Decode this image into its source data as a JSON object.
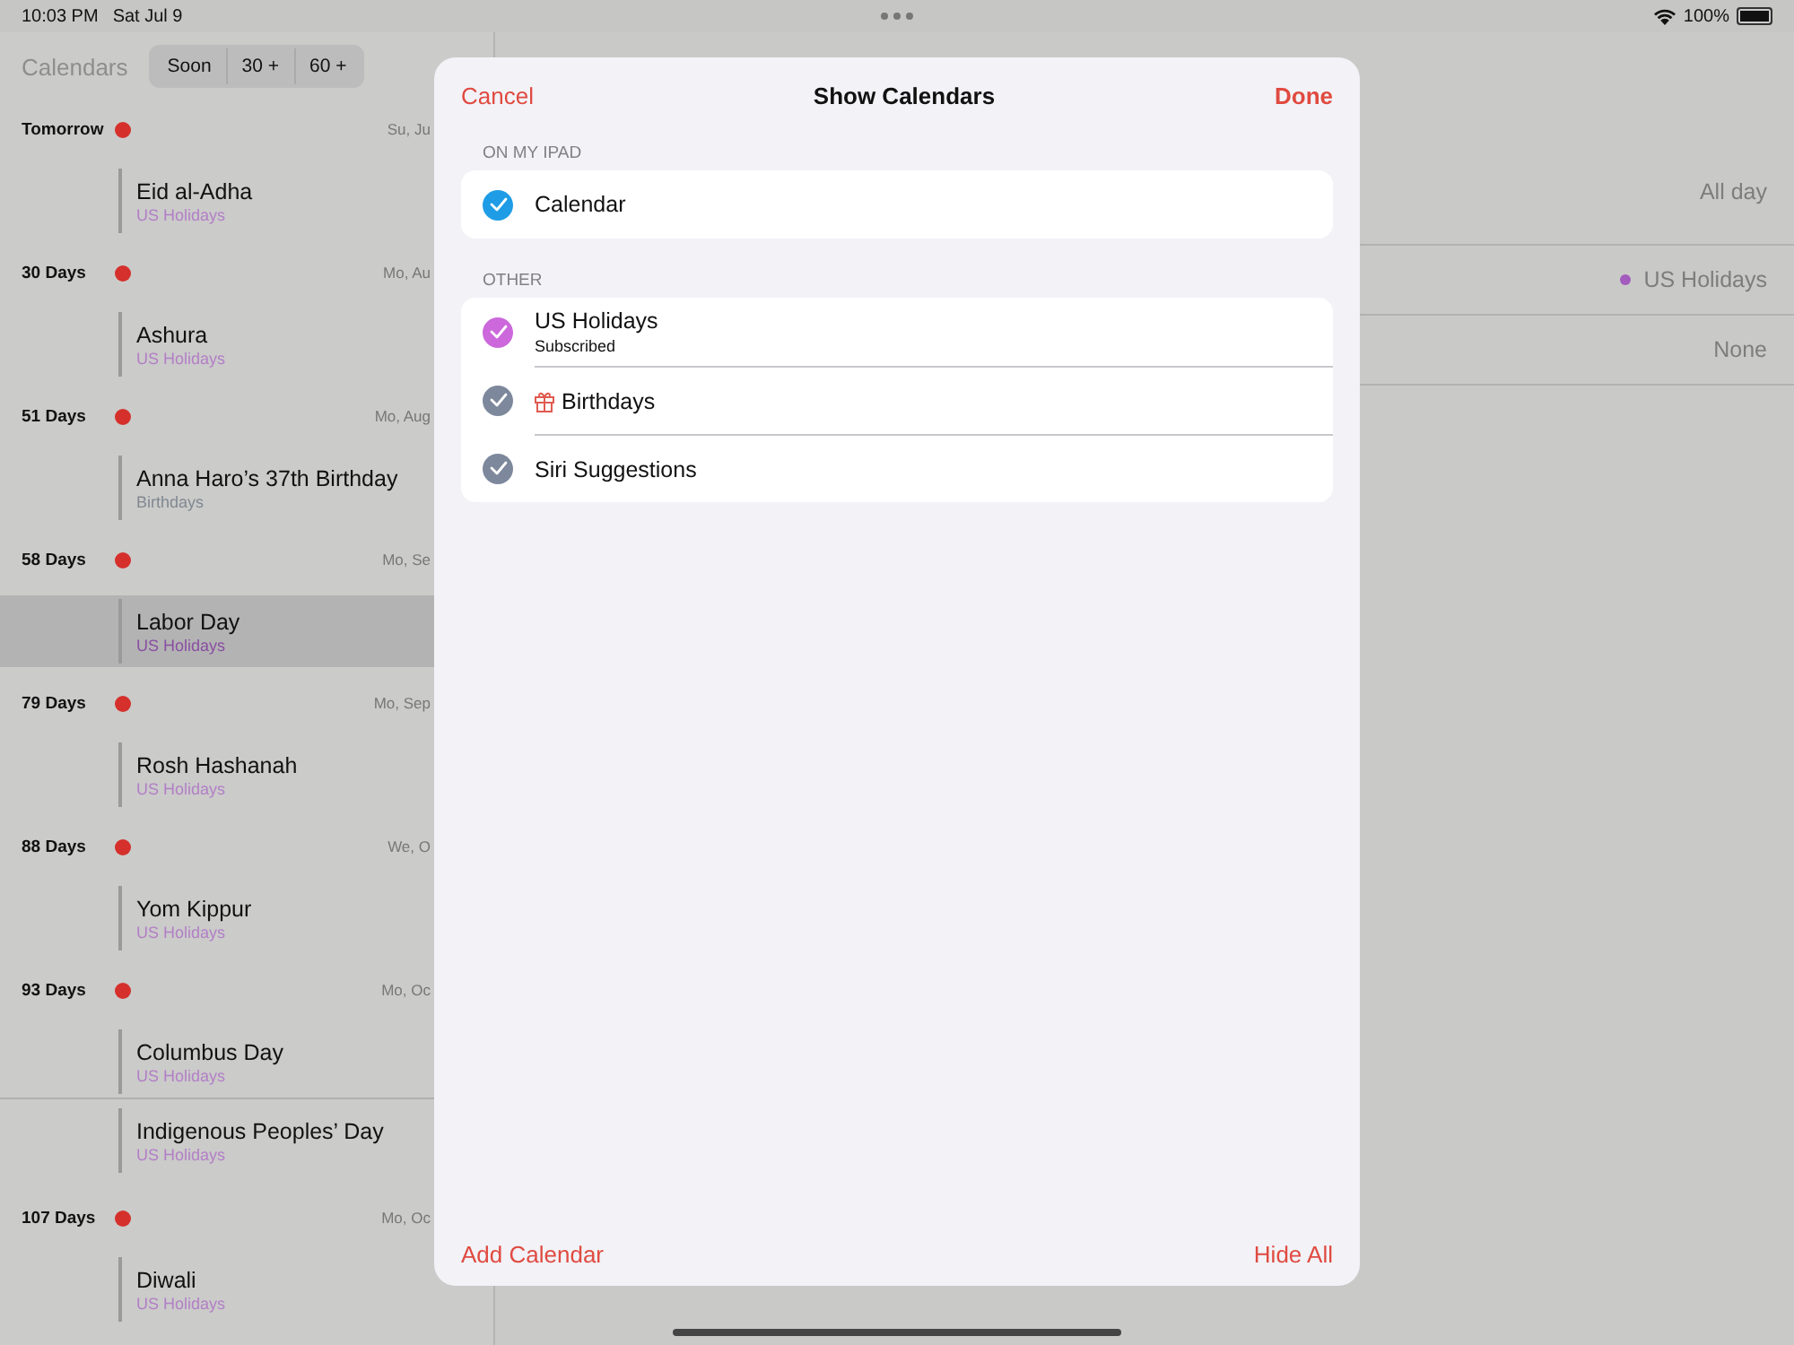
{
  "status_bar": {
    "time": "10:03 PM",
    "date": "Sat Jul 9",
    "battery": "100%"
  },
  "sidebar": {
    "title": "Calendars",
    "segments": [
      "Soon",
      "30 +",
      "60 +"
    ],
    "groups": [
      {
        "label": "Tomorrow",
        "date": "Su, Ju",
        "events": [
          {
            "title": "Eid al-Adha",
            "calendar": "US Holidays",
            "color": "#b27fc6",
            "selected": false
          }
        ]
      },
      {
        "label": "30 Days",
        "date": "Mo, Au",
        "events": [
          {
            "title": "Ashura",
            "calendar": "US Holidays",
            "color": "#b27fc6",
            "selected": false
          }
        ]
      },
      {
        "label": "51 Days",
        "date": "Mo, Aug",
        "events": [
          {
            "title": "Anna Haro’s 37th Birthday",
            "calendar": "Birthdays",
            "color": "#808890",
            "selected": false
          }
        ]
      },
      {
        "label": "58 Days",
        "date": "Mo, Se",
        "events": [
          {
            "title": "Labor Day",
            "calendar": "US Holidays",
            "color": "#8a4fa3",
            "selected": true
          }
        ]
      },
      {
        "label": "79 Days",
        "date": "Mo, Sep",
        "events": [
          {
            "title": "Rosh Hashanah",
            "calendar": "US Holidays",
            "color": "#b27fc6",
            "selected": false
          }
        ]
      },
      {
        "label": "88 Days",
        "date": "We, O",
        "events": [
          {
            "title": "Yom Kippur",
            "calendar": "US Holidays",
            "color": "#b27fc6",
            "selected": false
          }
        ]
      },
      {
        "label": "93 Days",
        "date": "Mo, Oc",
        "events": [
          {
            "title": "Columbus Day",
            "calendar": "US Holidays",
            "color": "#b27fc6",
            "selected": false
          },
          {
            "title": "Indigenous Peoples’ Day",
            "calendar": "US Holidays",
            "color": "#b27fc6",
            "selected": false
          }
        ]
      },
      {
        "label": "107 Days",
        "date": "Mo, Oc",
        "events": [
          {
            "title": "Diwali",
            "calendar": "US Holidays",
            "color": "#b27fc6",
            "selected": false
          }
        ]
      }
    ]
  },
  "detail": {
    "rows": [
      {
        "kind": "text",
        "value": "All day"
      },
      {
        "kind": "calendar",
        "value": "US Holidays",
        "color": "#a35bbd"
      },
      {
        "kind": "text",
        "value": "None"
      }
    ]
  },
  "modal": {
    "title": "Show Calendars",
    "cancel": "Cancel",
    "done": "Done",
    "sections": [
      {
        "header": "ON MY IPAD",
        "items": [
          {
            "kind": "plain",
            "name": "Calendar",
            "checked": true,
            "color": "#1e9de6"
          }
        ]
      },
      {
        "header": "OTHER",
        "items": [
          {
            "kind": "plain",
            "name": "US Holidays",
            "subtitle": "Subscribed",
            "checked": true,
            "color": "#cc68dc"
          },
          {
            "kind": "gift",
            "name": "Birthdays",
            "checked": true,
            "color": "#7d889c"
          },
          {
            "kind": "plain",
            "name": "Siri Suggestions",
            "checked": true,
            "color": "#7d889c"
          }
        ]
      }
    ],
    "add": "Add Calendar",
    "hide": "Hide All"
  }
}
